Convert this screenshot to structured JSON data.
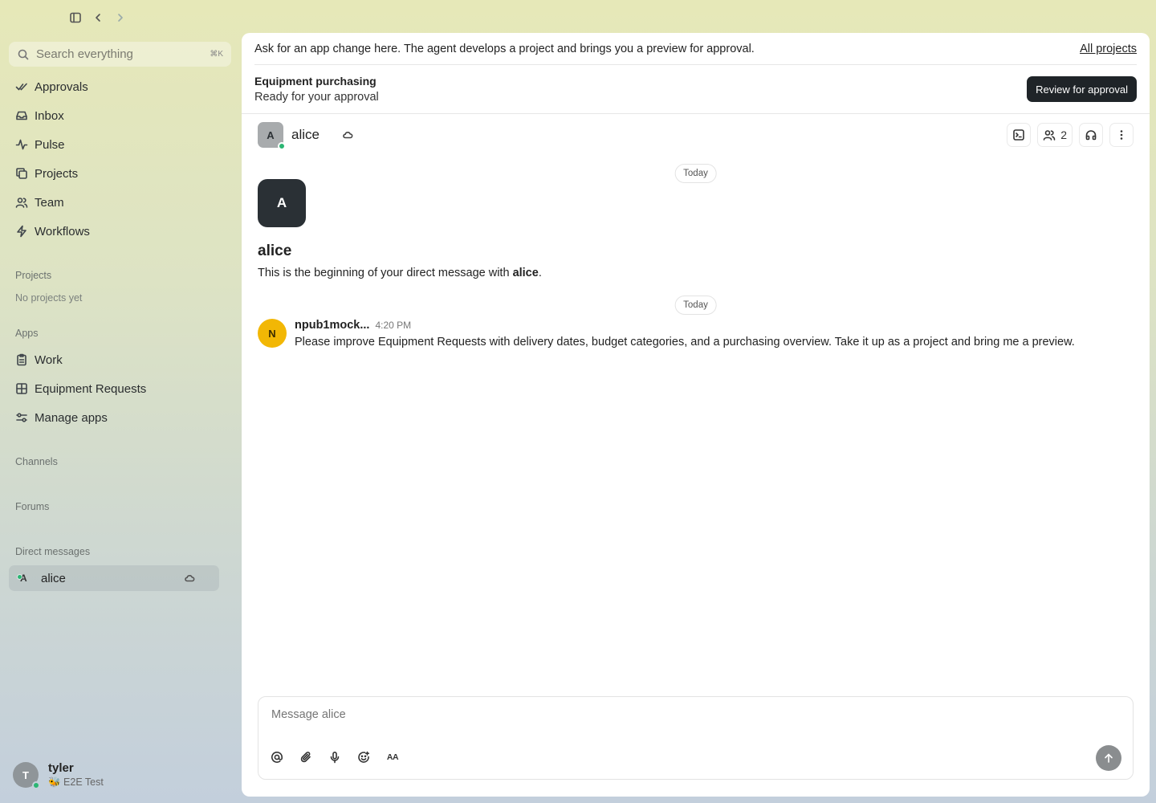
{
  "sidebar": {
    "search": {
      "placeholder": "Search everything",
      "shortcut": "⌘K"
    },
    "nav": [
      {
        "label": "Approvals",
        "icon": "check-double-icon"
      },
      {
        "label": "Inbox",
        "icon": "inbox-icon"
      },
      {
        "label": "Pulse",
        "icon": "activity-icon"
      },
      {
        "label": "Projects",
        "icon": "copy-icon"
      },
      {
        "label": "Team",
        "icon": "users-icon"
      },
      {
        "label": "Workflows",
        "icon": "bolt-icon"
      }
    ],
    "projects_label": "Projects",
    "projects_empty": "No projects yet",
    "apps_label": "Apps",
    "apps": [
      {
        "label": "Work",
        "icon": "clipboard-icon"
      },
      {
        "label": "Equipment Requests",
        "icon": "table-icon"
      },
      {
        "label": "Manage apps",
        "icon": "sliders-icon"
      }
    ],
    "channels_label": "Channels",
    "forums_label": "Forums",
    "dm_label": "Direct messages",
    "dm_items": [
      {
        "initial": "A",
        "name": "alice",
        "online": true
      }
    ],
    "user": {
      "initial": "T",
      "name": "tyler",
      "status": "🐝 E2E Test",
      "online": true
    }
  },
  "main": {
    "banner": {
      "text": "Ask for an app change here. The agent develops a project and brings you a preview for approval.",
      "link": "All projects"
    },
    "project": {
      "title": "Equipment purchasing",
      "status": "Ready for your approval",
      "button": "Review for approval"
    },
    "channel": {
      "initial": "A",
      "name": "alice",
      "member_count": "2"
    },
    "day_labels": [
      "Today",
      "Today"
    ],
    "intro": {
      "initial": "A",
      "name": "alice",
      "text_prefix": "This is the beginning of your direct message with ",
      "text_name": "alice",
      "text_suffix": "."
    },
    "messages": [
      {
        "initial": "N",
        "author": "npub1mock...",
        "time": "4:20 PM",
        "text": "Please improve Equipment Requests with delivery dates, budget categories, and a purchasing overview. Take it up as a project and bring me a preview."
      }
    ],
    "composer": {
      "placeholder": "Message alice",
      "format_label": "AA"
    }
  },
  "colors": {
    "accent_dark": "#1f2428",
    "online": "#2bb673",
    "author_avatar": "#f2b705"
  }
}
